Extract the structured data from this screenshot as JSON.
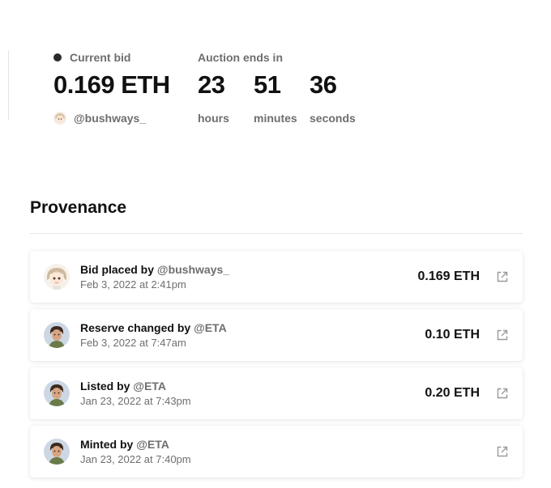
{
  "auction": {
    "bid_label": "Current bid",
    "bid_amount": "0.169 ETH",
    "bidder": "@bushways_",
    "ends_label": "Auction ends in",
    "countdown": [
      {
        "value": "23",
        "unit": "hours"
      },
      {
        "value": "51",
        "unit": "minutes"
      },
      {
        "value": "36",
        "unit": "seconds"
      }
    ]
  },
  "provenance": {
    "title": "Provenance",
    "events": [
      {
        "action": "Bid placed by ",
        "user": "@bushways_",
        "date": "Feb 3, 2022 at 2:41pm",
        "amount": "0.169 ETH",
        "avatar": "anime-avatar"
      },
      {
        "action": "Reserve changed by ",
        "user": "@ETA",
        "date": "Feb 3, 2022 at 7:47am",
        "amount": "0.10 ETH",
        "avatar": "portrait-avatar"
      },
      {
        "action": "Listed by ",
        "user": "@ETA",
        "date": "Jan 23, 2022 at 7:43pm",
        "amount": "0.20 ETH",
        "avatar": "portrait-avatar"
      },
      {
        "action": "Minted by ",
        "user": "@ETA",
        "date": "Jan 23, 2022 at 7:40pm",
        "amount": "",
        "avatar": "portrait-avatar"
      }
    ]
  },
  "icons": {
    "status_dot": "dot-icon",
    "external": "external-link-icon"
  },
  "colors": {
    "text": "#111111",
    "muted": "#6e6e6e",
    "dot": "#2a2a2a",
    "divider": "#e6e6e6"
  }
}
